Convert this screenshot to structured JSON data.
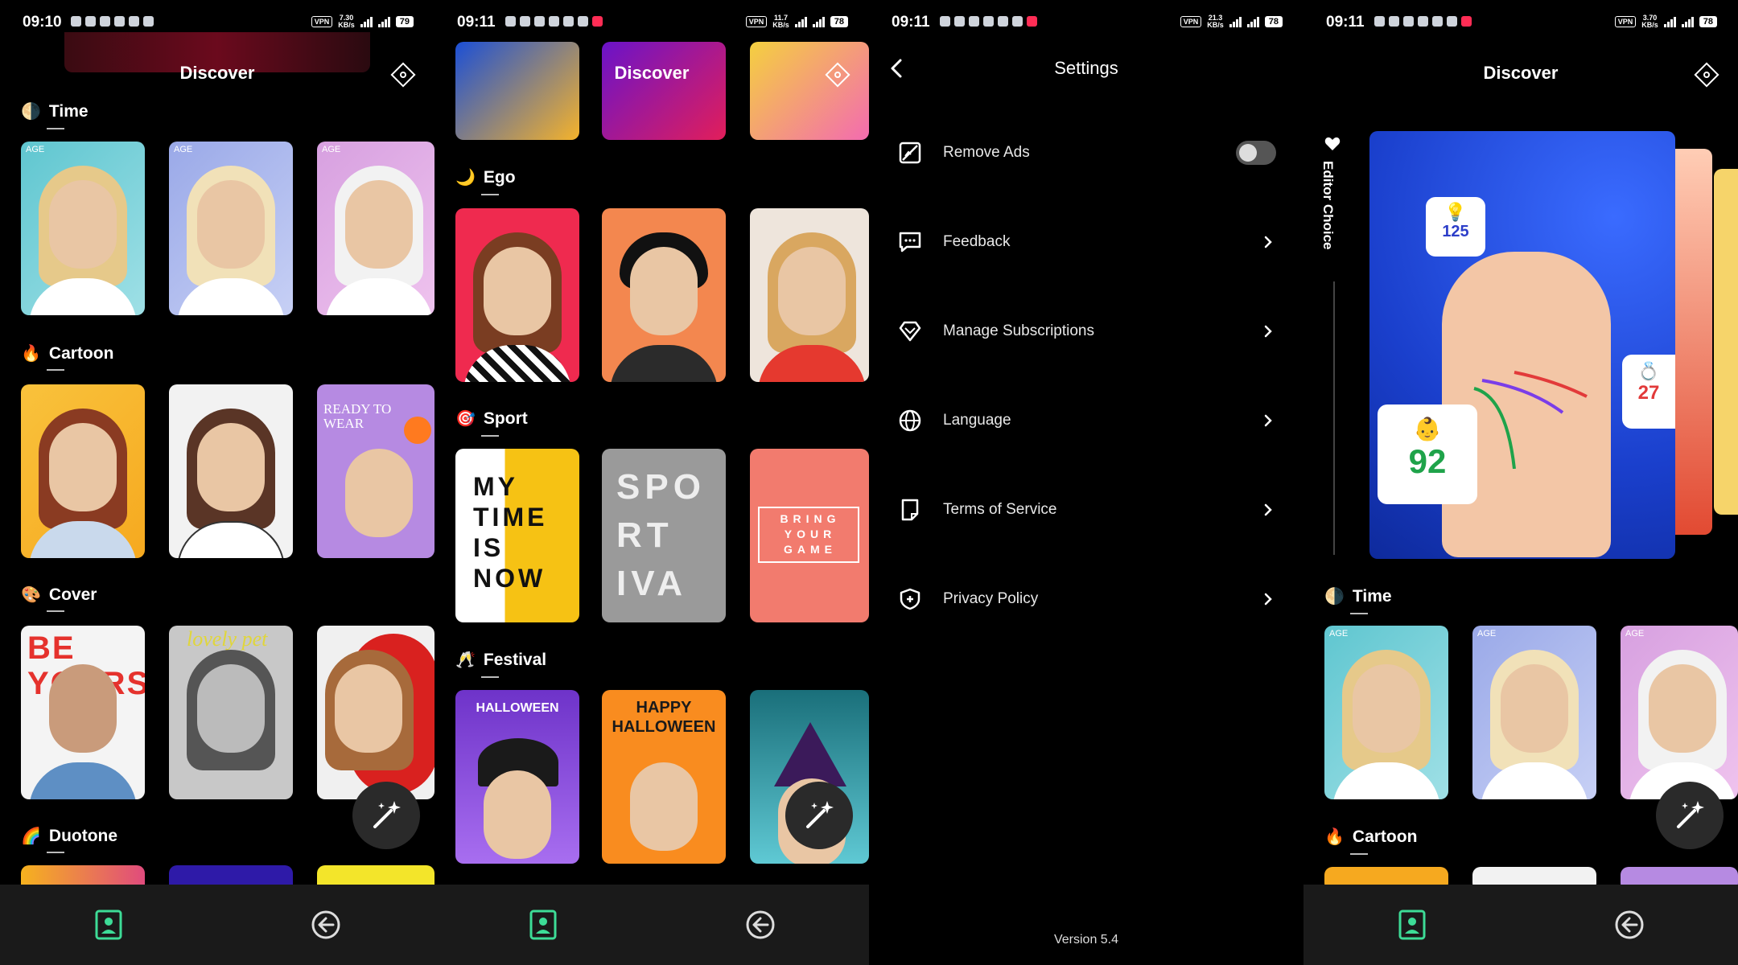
{
  "status": {
    "s1": {
      "time": "09:10",
      "net_top": "7.30",
      "net_bot": "KB/s",
      "battery": "79"
    },
    "s2": {
      "time": "09:11",
      "net_top": "11.7",
      "net_bot": "KB/s",
      "battery": "78"
    },
    "s3": {
      "time": "09:11",
      "net_top": "21.3",
      "net_bot": "KB/s",
      "battery": "78"
    },
    "s4": {
      "time": "09:11",
      "net_top": "3.70",
      "net_bot": "KB/s",
      "battery": "78"
    },
    "vpn": "VPN"
  },
  "discover": {
    "title": "Discover",
    "sections": {
      "time": {
        "emoji": "🌗",
        "label": "Time"
      },
      "cartoon": {
        "emoji": "🔥",
        "label": "Cartoon"
      },
      "cover": {
        "emoji": "🎨",
        "label": "Cover"
      },
      "duotone": {
        "emoji": "🌈",
        "label": "Duotone"
      },
      "ego": {
        "emoji": "🌙",
        "label": "Ego"
      },
      "sport": {
        "emoji": "🎯",
        "label": "Sport"
      },
      "festival": {
        "emoji": "🥂",
        "label": "Festival"
      }
    },
    "card_text": {
      "age": "AGE",
      "ready": "READY TO WEAR",
      "be_yourself": "BE YOURSELF",
      "lovely_pet": "lovely pet",
      "my_time": "MY TIME IS NOW",
      "sport_iva": "SPO RT IVA",
      "bring_game": "BRING YOUR GAME",
      "halloween": "HALLOWEEN",
      "happy_halloween": "HAPPY HALLOWEEN"
    }
  },
  "settings": {
    "title": "Settings",
    "items": [
      {
        "label": "Remove Ads",
        "icon": "remove-ads-icon"
      },
      {
        "label": "Feedback",
        "icon": "feedback-icon"
      },
      {
        "label": "Manage Subscriptions",
        "icon": "diamond-icon"
      },
      {
        "label": "Language",
        "icon": "globe-icon"
      },
      {
        "label": "Terms of Service",
        "icon": "document-icon"
      },
      {
        "label": "Privacy Policy",
        "icon": "shield-icon"
      }
    ],
    "version": "Version 5.4"
  },
  "editor": {
    "label": "Editor Choice",
    "badge_top": "125",
    "badge_left": "92",
    "badge_right": "27"
  },
  "colors": {
    "accent_green": "#3ddc97",
    "background": "#000000",
    "nav_bg": "#1a1a1a"
  }
}
